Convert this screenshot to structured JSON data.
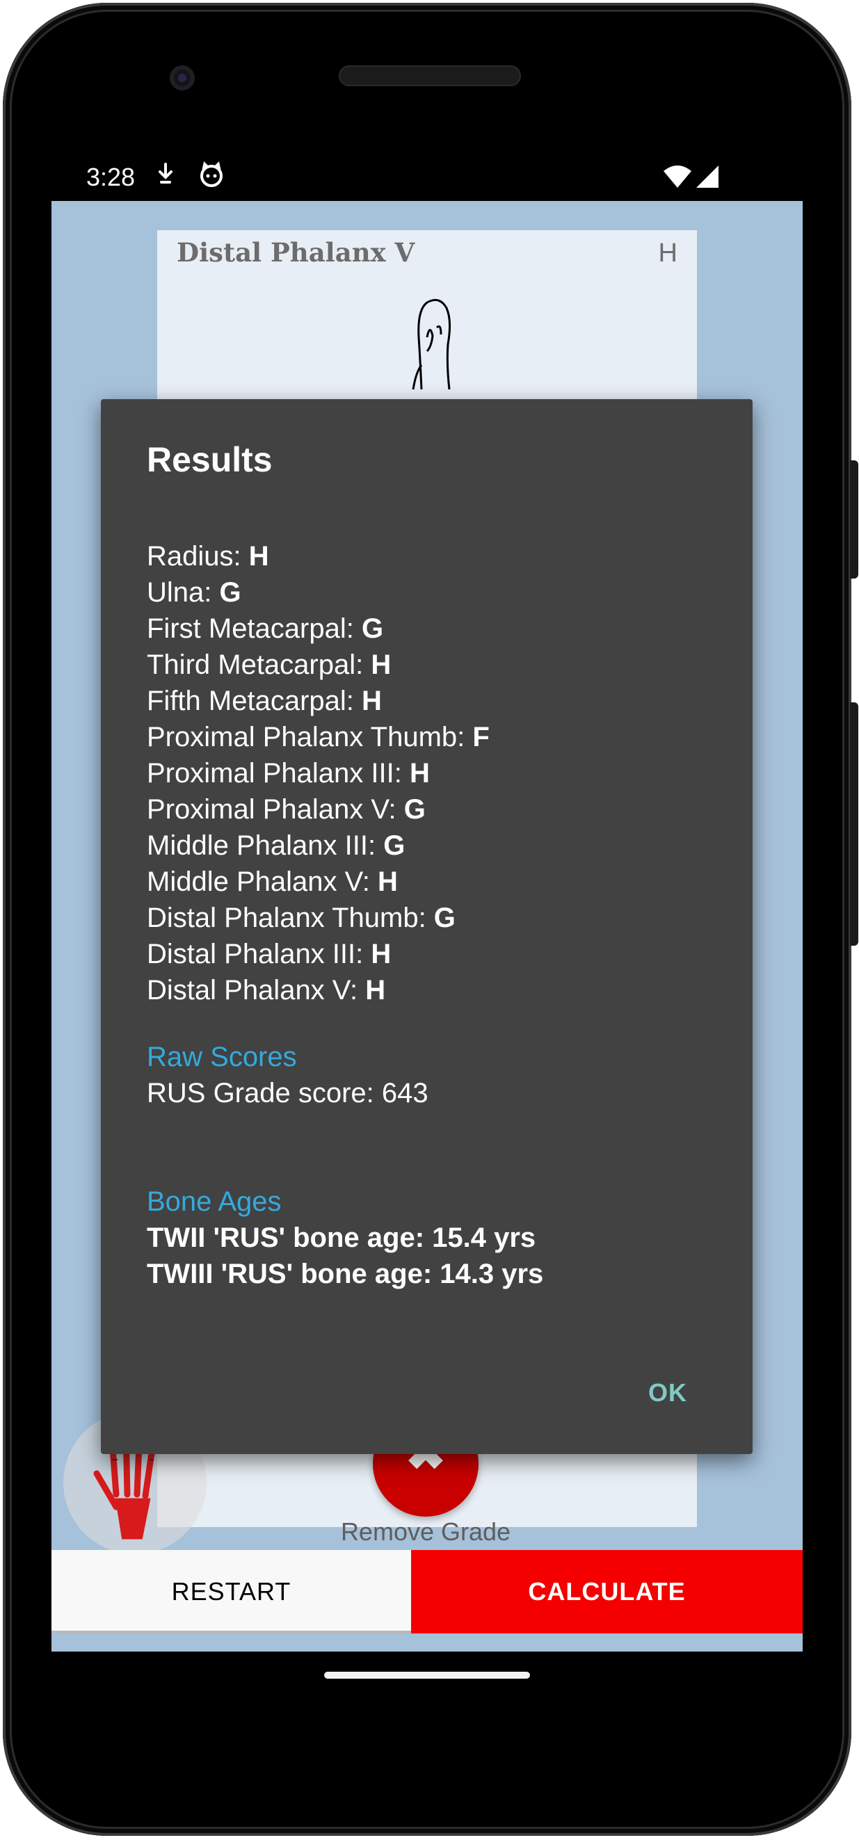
{
  "status_bar": {
    "time": "3:28",
    "icons": [
      "download-icon",
      "cat-face-icon",
      "wifi-icon",
      "signal-icon"
    ]
  },
  "card": {
    "title": "Distal Phalanx V",
    "grade": "H"
  },
  "dialog": {
    "title": "Results",
    "grades": [
      {
        "label": "Radius: ",
        "value": "H"
      },
      {
        "label": "Ulna: ",
        "value": "G"
      },
      {
        "label": "First Metacarpal: ",
        "value": "G"
      },
      {
        "label": "Third Metacarpal: ",
        "value": "H"
      },
      {
        "label": "Fifth Metacarpal: ",
        "value": "H"
      },
      {
        "label": "Proximal Phalanx Thumb: ",
        "value": "F"
      },
      {
        "label": "Proximal Phalanx III: ",
        "value": "H"
      },
      {
        "label": "Proximal Phalanx V: ",
        "value": "G"
      },
      {
        "label": "Middle Phalanx III: ",
        "value": "G"
      },
      {
        "label": "Middle Phalanx V: ",
        "value": "H"
      },
      {
        "label": "Distal Phalanx Thumb: ",
        "value": "G"
      },
      {
        "label": "Distal Phalanx III: ",
        "value": "H"
      },
      {
        "label": "Distal Phalanx V: ",
        "value": "H"
      }
    ],
    "raw_scores_heading": "Raw Scores",
    "rus_grade_score": "RUS Grade score: 643",
    "bone_ages_heading": "Bone Ages",
    "twii_age": "TWII 'RUS' bone age: 15.4 yrs",
    "twiii_age": "TWIII 'RUS' bone age: 14.3 yrs",
    "ok_label": "OK"
  },
  "remove_label": "Remove Grade",
  "buttons": {
    "restart": "RESTART",
    "calculate": "CALCULATE"
  },
  "colors": {
    "screen_bg": "#a6c1da",
    "dialog_bg": "#424242",
    "section_heading": "#33aade",
    "ok": "#80cbc4",
    "calculate_bg": "#f40000",
    "remove_fab": "#c90000"
  }
}
